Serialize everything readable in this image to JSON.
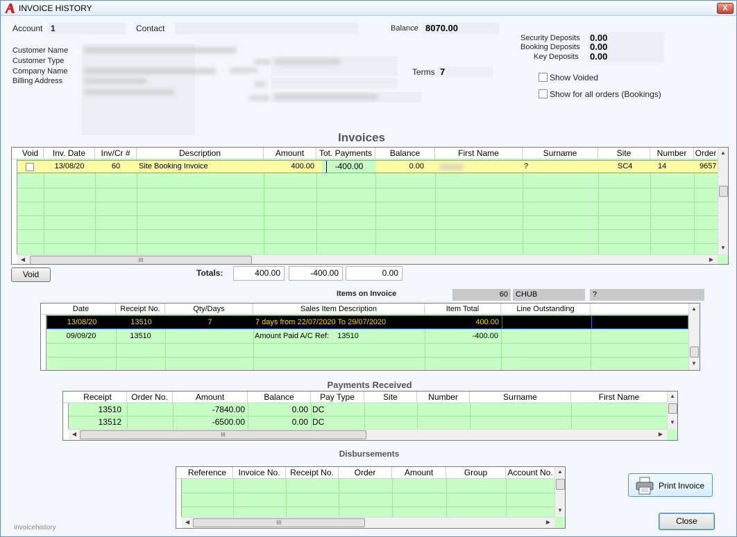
{
  "window": {
    "title": "INVOICE HISTORY",
    "close_glyph": "X"
  },
  "account": {
    "account_label": "Account",
    "account_value": "1",
    "contact_label": "Contact",
    "contact_value": "",
    "balance_label": "Balance",
    "balance_value": "8070.00",
    "customer_name_label": "Customer Name",
    "customer_type_label": "Customer Type",
    "company_name_label": "Company Name",
    "billing_address_label": "Billing Address",
    "terms_label": "Terms",
    "terms_value": "7",
    "security_deposits_label": "Security Deposits",
    "security_deposits_value": "0.00",
    "booking_deposits_label": "Booking Deposits",
    "booking_deposits_value": "0.00",
    "key_deposits_label": "Key Deposits",
    "key_deposits_value": "0.00"
  },
  "options": {
    "show_voided": "Show Voided",
    "show_all_orders": "Show for all orders (Bookings)"
  },
  "invoices": {
    "title": "Invoices",
    "columns": [
      "Void",
      "Inv. Date",
      "Inv/Cr #",
      "Description",
      "Amount",
      "Tot. Payments",
      "Balance",
      "First Name",
      "Surname",
      "Site",
      "Number",
      "Order"
    ],
    "rows": [
      {
        "void": "",
        "date": "13/08/20",
        "inv": "60",
        "description": "Site Booking Invoice",
        "amount": "400.00",
        "payments": "-400.00",
        "balance": "0.00",
        "first_name": "",
        "surname": "?",
        "site": "SC4",
        "number": "14",
        "order": "9657"
      }
    ],
    "void_button": "Void",
    "totals_label": "Totals:",
    "total_amount": "400.00",
    "total_payments": "-400.00",
    "total_balance": "0.00"
  },
  "items": {
    "title": "Items on Invoice",
    "invoice_no": "60",
    "site_code": "CHUB",
    "extra": "?",
    "columns": [
      "Date",
      "Receipt No.",
      "Qty/Days",
      "Sales Item Description",
      "Item Total",
      "Line Outstanding"
    ],
    "rows": [
      {
        "date": "13/08/20",
        "receipt": "13510",
        "qty": "7",
        "description": "7 days from 22/07/2020 To 29/07/2020",
        "total": "400.00",
        "outstanding": ""
      },
      {
        "date": "09/09/20",
        "receipt": "13510",
        "qty": "",
        "description": "Amount Paid A/C Ref:    13510",
        "total": "-400.00",
        "outstanding": ""
      }
    ]
  },
  "payments": {
    "title": "Payments Received",
    "columns": [
      "Receipt",
      "Order No.",
      "Amount",
      "Balance",
      "Pay Type",
      "Site",
      "Number",
      "Surname",
      "First Name"
    ],
    "rows": [
      {
        "receipt": "13510",
        "order": "",
        "amount": "-7840.00",
        "balance": "0.00",
        "pay_type": "DC"
      },
      {
        "receipt": "13512",
        "order": "",
        "amount": "-6500.00",
        "balance": "0.00",
        "pay_type": "DC"
      }
    ]
  },
  "disbursements": {
    "title": "Disbursements",
    "columns": [
      "Reference",
      "Invoice No.",
      "Receipt No.",
      "Order",
      "Amount",
      "Group",
      "Account No."
    ]
  },
  "buttons": {
    "print_invoice": "Print Invoice",
    "close": "Close"
  },
  "footer": {
    "form_name": "invoicehistory"
  },
  "scroll": {
    "grip": "III",
    "up": "▲",
    "down": "▼",
    "left": "◀",
    "right": "▶"
  }
}
